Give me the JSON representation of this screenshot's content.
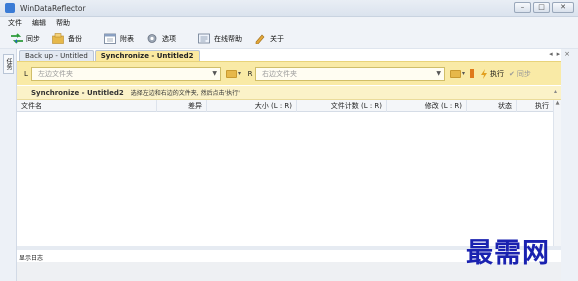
{
  "window": {
    "title": "WinDataReflector",
    "buttons": [
      "–",
      "□",
      "✕"
    ]
  },
  "menu": [
    {
      "label": "文件"
    },
    {
      "label": "编辑"
    },
    {
      "label": "帮助"
    }
  ],
  "toolbar": [
    {
      "label": "同步",
      "icon": "sync-arrows-icon"
    },
    {
      "label": "备份",
      "icon": "backup-icon"
    },
    {
      "label": "附表",
      "icon": "schedule-icon"
    },
    {
      "label": "选项",
      "icon": "gear-icon"
    },
    {
      "label": "在线帮助",
      "icon": "online-help-icon"
    },
    {
      "label": "关于",
      "icon": "about-icon"
    }
  ],
  "side_tab": {
    "label": "任务"
  },
  "tabs": [
    {
      "label": "Back up - Untitled",
      "active": false
    },
    {
      "label": "Synchronize - Untitled2",
      "active": true
    }
  ],
  "tab_nav": {
    "prev": "◂",
    "next": "▸",
    "close": "×"
  },
  "pathbar": {
    "left_letter": "L",
    "left_placeholder": "左边文件夹",
    "right_letter": "R",
    "right_placeholder": "右边文件夹",
    "execute_label": "执行",
    "sync_label": "同步"
  },
  "info": {
    "title": "Synchronize - Untitled2",
    "desc": "选择左边和右边的文件夹, 然后点击'执行'"
  },
  "table": {
    "columns": [
      "文件名",
      "差异",
      "大小 (L : R)",
      "文件计数 (L : R)",
      "修改 (L : R)",
      "状态",
      "执行"
    ]
  },
  "log": {
    "label": "显示日志"
  },
  "watermark": "最需网",
  "colors": {
    "accent_yellow": "#f9eaa6",
    "tab_active": "#fbe9a0",
    "watermark": "#1a22b0"
  }
}
